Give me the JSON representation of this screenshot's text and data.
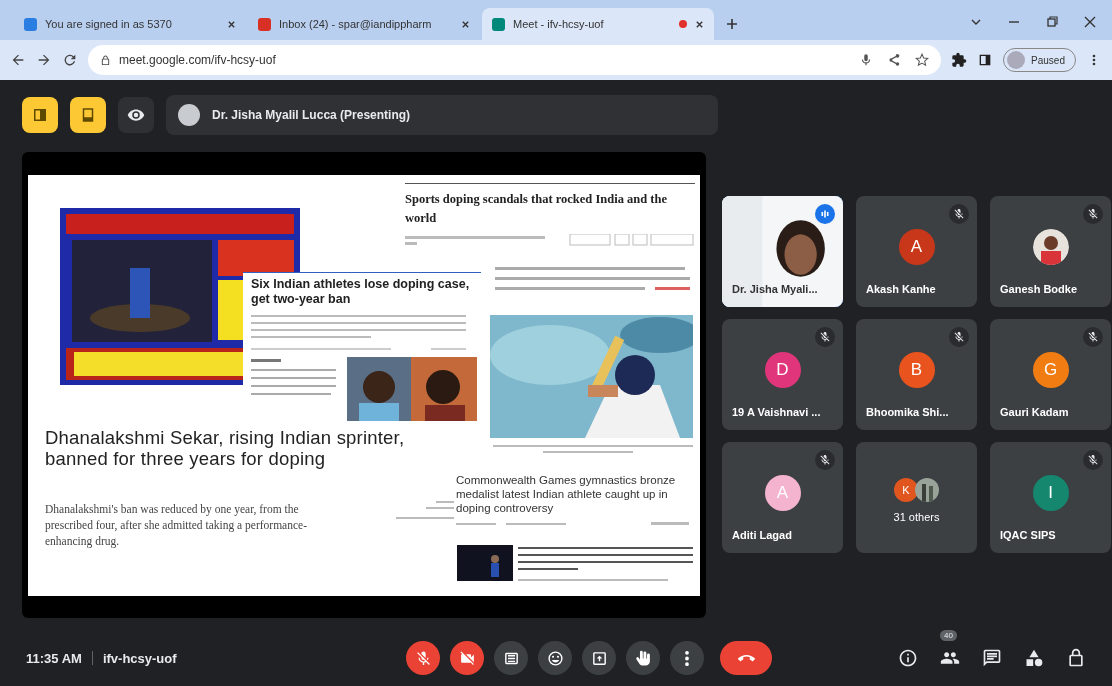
{
  "browser": {
    "tabs": [
      {
        "title": "You are signed in as 5370",
        "kind": "doc",
        "selected": false,
        "recording": false
      },
      {
        "title": "Inbox (24) - spar@iandippharm",
        "kind": "mail",
        "selected": false,
        "recording": false
      },
      {
        "title": "Meet - ifv-hcsy-uof",
        "kind": "meet",
        "selected": true,
        "recording": true
      }
    ],
    "address": "meet.google.com/ifv-hcsy-uof",
    "profile": "Paused"
  },
  "view_buttons": [
    {
      "kind": "pin",
      "on": true
    },
    {
      "kind": "dock",
      "on": true
    },
    {
      "kind": "eye",
      "on": false
    }
  ],
  "presenter": {
    "name": "Dr. Jisha Myalil Lucca (Presenting)"
  },
  "slide": {
    "sports_title": "Sports doping scandals that rocked India and the world",
    "six_title": "Six Indian athletes lose doping case, get two-year ban",
    "main_headline": "Dhanalakshmi Sekar, rising Indian sprinter, banned for three years for doping",
    "main_text": "Dhanalakshmi's ban was reduced by one year, from the prescribed four, after she admitted taking a performance-enhancing drug.",
    "cwg_title": "Commonwealth Games gymnastics bronze medalist latest Indian athlete caught up in doping controversy"
  },
  "participants": [
    {
      "name": "Dr. Jisha Myali...",
      "kind": "video",
      "muted": false,
      "speaking": true
    },
    {
      "name": "Akash Kanhe",
      "kind": "letter",
      "initial": "A",
      "color": "#c8371a",
      "muted": true,
      "speaking": false
    },
    {
      "name": "Ganesh Bodke",
      "muted": true,
      "speaking": false
    },
    {
      "name": "19 A Vaishnavi ...",
      "kind": "letter",
      "initial": "D",
      "color": "#e0357a",
      "muted": true,
      "speaking": false
    },
    {
      "name": "Bhoomika Shi...",
      "kind": "letter",
      "initial": "B",
      "color": "#e9541e",
      "muted": true,
      "speaking": false
    },
    {
      "name": "Gauri Kadam",
      "kind": "letter",
      "initial": "G",
      "color": "#f07c12",
      "muted": true,
      "speaking": false
    },
    {
      "name": "Aditi Lagad",
      "kind": "letter",
      "initial": "A",
      "color": "#f4b3cf",
      "muted": true,
      "speaking": false
    },
    {
      "name": "31 others",
      "kind": "group",
      "initial": "K",
      "color": "#e0561e",
      "muted": false,
      "speaking": false
    },
    {
      "name": "IQAC SIPS",
      "kind": "letter",
      "initial": "I",
      "color": "#14876e",
      "muted": true,
      "speaking": false
    }
  ],
  "footer": {
    "time": "11:35 AM",
    "meeting_code": "ifv-hcsy-uof",
    "controls": [
      {
        "kind": "mic",
        "on": false
      },
      {
        "kind": "camera",
        "on": false
      },
      {
        "kind": "captions",
        "on": true
      },
      {
        "kind": "emoji",
        "on": true
      },
      {
        "kind": "present",
        "on": true
      },
      {
        "kind": "hand",
        "on": true
      },
      {
        "kind": "more",
        "on": true
      },
      {
        "kind": "end"
      }
    ],
    "panel": [
      {
        "kind": "info"
      },
      {
        "kind": "people",
        "badge": "40"
      },
      {
        "kind": "chat"
      },
      {
        "kind": "activities"
      },
      {
        "kind": "lock"
      }
    ]
  }
}
